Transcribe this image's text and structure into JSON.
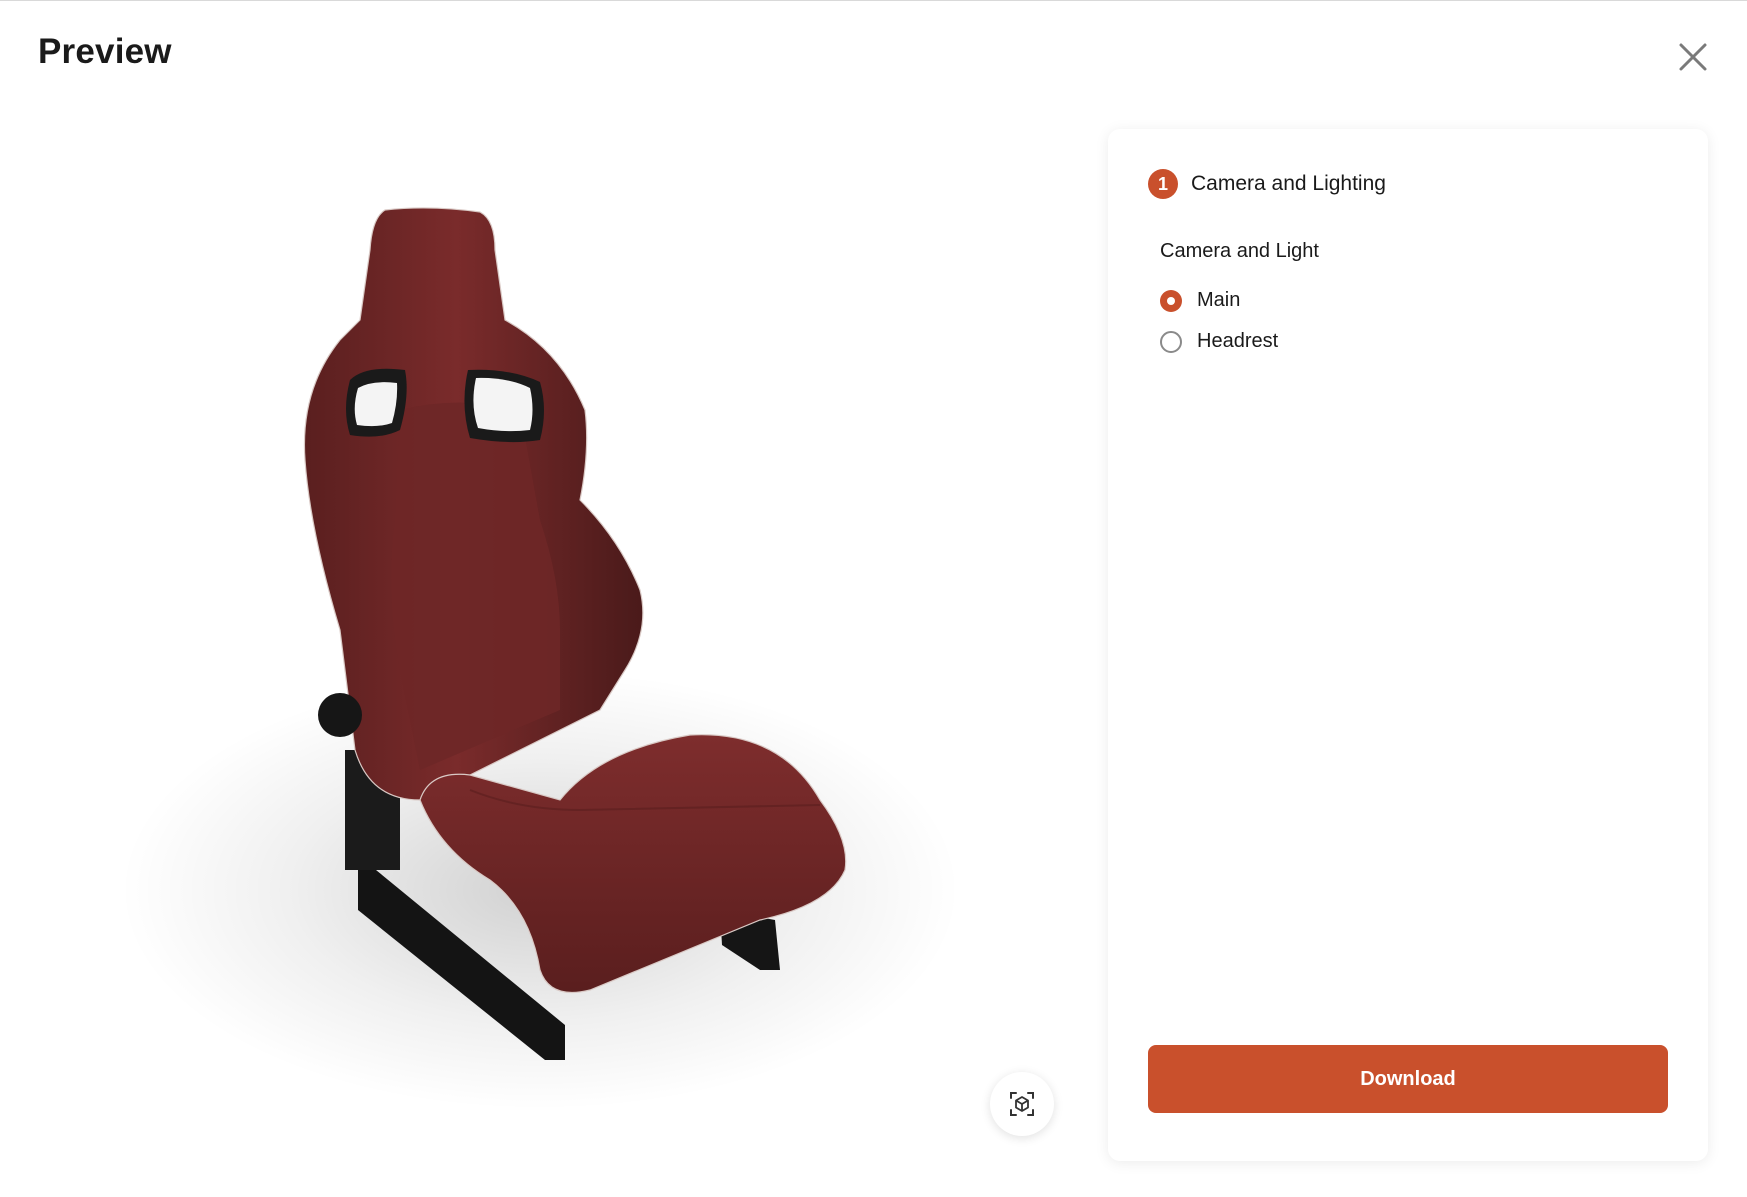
{
  "modal": {
    "title": "Preview"
  },
  "icons": {
    "close": "close-icon",
    "ar_view": "ar-cube-icon"
  },
  "panel": {
    "step": {
      "number": "1",
      "title": "Camera and Lighting"
    },
    "group_label": "Camera and Light",
    "options": [
      {
        "label": "Main",
        "selected": true
      },
      {
        "label": "Headrest",
        "selected": false
      }
    ],
    "download_label": "Download"
  },
  "colors": {
    "accent": "#c9502c",
    "seat_leather": "#6b2525"
  }
}
